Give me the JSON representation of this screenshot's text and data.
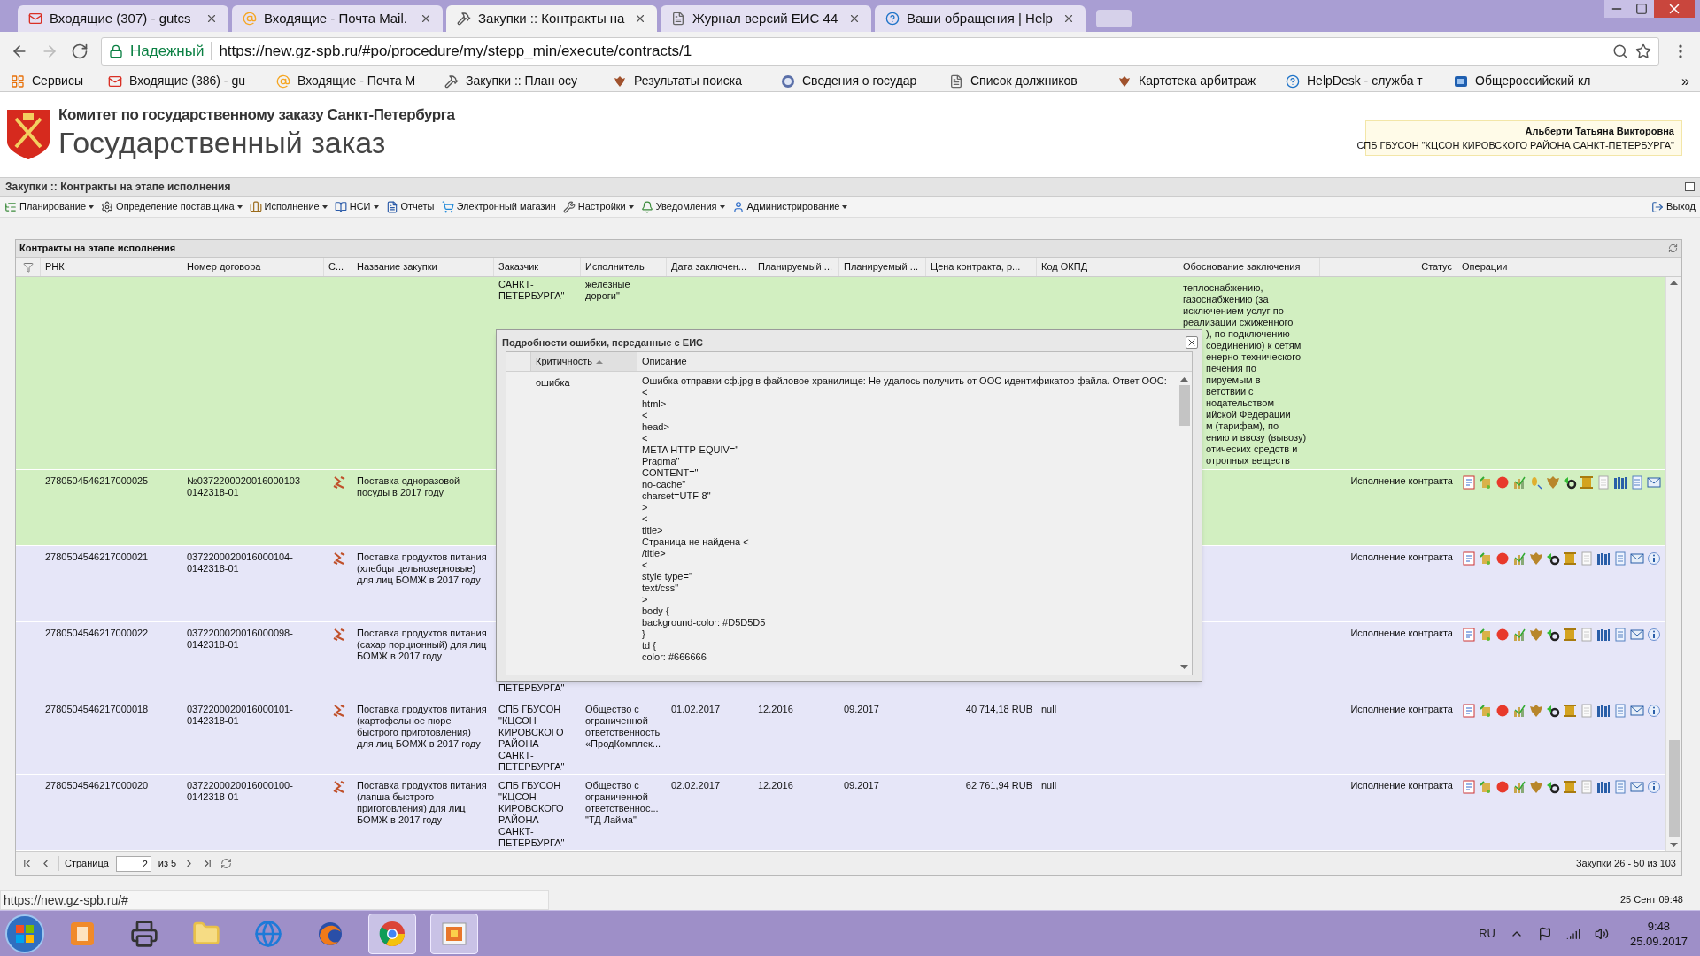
{
  "browser": {
    "tabs": [
      {
        "title": "Входящие (307) - gutcs",
        "selected": false,
        "kind": "mail"
      },
      {
        "title": "Входящие - Почта Mail.",
        "selected": false,
        "kind": "at"
      },
      {
        "title": "Закупки :: Контракты на",
        "selected": true,
        "kind": "hammer"
      },
      {
        "title": "Журнал версий ЕИС 44",
        "selected": false,
        "kind": "page"
      },
      {
        "title": "Ваши обращения | Help",
        "selected": false,
        "kind": "help"
      }
    ],
    "security_label": "Надежный",
    "url": "https://new.gz-spb.ru/#po/procedure/my/stepp_min/execute/contracts/1",
    "bookmarks": [
      {
        "label": "Сервисы",
        "kind": "apps"
      },
      {
        "label": "Входящие (386) - gu",
        "kind": "mail"
      },
      {
        "label": "Входящие - Почта М",
        "kind": "at"
      },
      {
        "label": "Закупки :: План осу",
        "kind": "hammer"
      },
      {
        "label": "Результаты поиска",
        "kind": "emblem"
      },
      {
        "label": "Сведения о государ",
        "kind": "seal"
      },
      {
        "label": "Список должников",
        "kind": "page"
      },
      {
        "label": "Картотека арбитраж",
        "kind": "emblem"
      },
      {
        "label": "HelpDesk - служба т",
        "kind": "help"
      },
      {
        "label": "Общероссийский кл",
        "kind": "logo"
      }
    ],
    "bookmarks_more": "»"
  },
  "header": {
    "organization": "Комитет по государственному заказу Санкт-Петербурга",
    "title": "Государственный заказ",
    "user_name": "Альберти Татьяна Викторовна",
    "user_org": "СПБ ГБУСОН \"КЦСОН КИРОВСКОГО РАЙОНА САНКТ-ПЕТЕРБУРГА\""
  },
  "page_title": "Закупки :: Контракты на этапе исполнения",
  "menu": [
    {
      "label": "Планирование",
      "dropdown": true,
      "kind": "plan"
    },
    {
      "label": "Определение поставщика",
      "dropdown": true,
      "kind": "gears"
    },
    {
      "label": "Исполнение",
      "dropdown": true,
      "kind": "briefcase"
    },
    {
      "label": "НСИ",
      "dropdown": true,
      "kind": "book"
    },
    {
      "label": "Отчеты",
      "dropdown": false,
      "kind": "report"
    },
    {
      "label": "Электронный магазин",
      "dropdown": false,
      "kind": "cart"
    },
    {
      "label": "Настройки",
      "dropdown": true,
      "kind": "wrench"
    },
    {
      "label": "Уведомления",
      "dropdown": true,
      "kind": "bell"
    },
    {
      "label": "Администрирование",
      "dropdown": true,
      "kind": "user"
    }
  ],
  "logout": "Выход",
  "grid": {
    "title": "Контракты на этапе исполнения",
    "columns": [
      "РНК",
      "Номер договора",
      "С...",
      "Название закупки",
      "Заказчик",
      "Исполнитель",
      "Дата заключен...",
      "Планируемый ...",
      "Планируемый ...",
      "Цена контракта, р...",
      "Код ОКПД",
      "Обоснование заключения",
      "Статус",
      "Операции"
    ],
    "rows": [
      {
        "color": "#d2efc1",
        "customer": "САНКТ-\nПЕТЕРБУРГА\"",
        "supplier": "железные\nдороги\"",
        "justification": [
          "теплоснабжению,",
          "газоснабжению (за",
          "исключением услуг по",
          "реализации сжиженного",
          "), по подключению",
          "соединению) к сетям",
          "енерно-технического",
          "печения по",
          "пируемым в",
          "ветствии с",
          "нодательством",
          "ийской Федерации",
          "м (тарифам), по",
          "ению и ввозу (вывозу)",
          "отических средств и",
          "отропных веществ"
        ]
      },
      {
        "color": "#d2efc1",
        "rnk": "2780504546217000025",
        "contract": "№0372200020016000103-0142318-01",
        "name": "Поставка одноразовой посуды в 2017 году",
        "status": "Исполнение контракта",
        "info_icon": false
      },
      {
        "color": "#e6e6f8",
        "rnk": "2780504546217000021",
        "contract": "0372200020016000104-0142318-01",
        "name": "Поставка продуктов питания (хлебцы цельнозерновые) для лиц БОМЖ в 2017 году",
        "status": "Исполнение контракта",
        "info_icon": true
      },
      {
        "color": "#e6e6f8",
        "rnk": "2780504546217000022",
        "contract": "0372200020016000098-0142318-01",
        "name": "Поставка продуктов питания (сахар порционный) для лиц БОМЖ в 2017 году",
        "customer_tail": "ПЕТЕРБУРГА\"",
        "status": "Исполнение контракта",
        "info_icon": true
      },
      {
        "color": "#e6e6f8",
        "rnk": "2780504546217000018",
        "contract": "0372200020016000101-0142318-01",
        "name": "Поставка продуктов питания (картофельное пюре быстрого приготовления) для лиц БОМЖ в 2017 году",
        "customer": "СПБ ГБУСОН\n\"КЦСОН\nКИРОВСКОГО\nРАЙОНА\nСАНКТ-\nПЕТЕРБУРГА\"",
        "supplier": "Общество с\nограниченной\nответственность\n«ПродКомплек...",
        "date": "01.02.2017",
        "plan_1": "12.2016",
        "plan_2": "09.2017",
        "price": "40 714,18 RUB",
        "okpd": "null",
        "status": "Исполнение контракта",
        "info_icon": true
      },
      {
        "color": "#e6e6f8",
        "rnk": "2780504546217000020",
        "contract": "0372200020016000100-0142318-01",
        "name": "Поставка продуктов питания (лапша быстрого приготовления) для лиц БОМЖ в 2017 году",
        "customer": "СПБ ГБУСОН\n\"КЦСОН\nКИРОВСКОГО\nРАЙОНА\nСАНКТ-\nПЕТЕРБУРГА\"",
        "supplier": "Общество с\nограниченной\nответственнос...\n\"ТД Лайма\"",
        "date": "02.02.2017",
        "plan_1": "12.2016",
        "plan_2": "09.2017",
        "price": "62 761,94 RUB",
        "okpd": "null",
        "status": "Исполнение контракта",
        "info_icon": true
      }
    ],
    "pager": {
      "page_label": "Страница",
      "page": "2",
      "of": "из 5"
    },
    "summary": "Закупки 26 - 50 из 103"
  },
  "dialog": {
    "title": "Подробности ошибки, переданные с ЕИС",
    "columns": [
      {
        "label": "Критичность",
        "sorted": true
      },
      {
        "label": "Описание",
        "sorted": false
      }
    ],
    "rows": [
      {
        "severity": "ошибка",
        "description": [
          "Ошибка отправки сф.jpg в файловое хранилище: Не удалось получить от ООС идентификатор файла. Ответ ООС:",
          "<",
          "html>",
          "<",
          "head>",
          "<",
          "META HTTP-EQUIV=\"",
          "Pragma\"",
          "CONTENT=\"",
          "no-cache\"",
          "charset=UTF-8\"",
          ">",
          "<",
          "title>",
          "Страница не найдена <",
          "/title>",
          "<",
          "style type=\"",
          "text/css\"",
          ">",
          "body {",
          "background-color: #D5D5D5",
          "}",
          "td {",
          "color: #666666"
        ]
      }
    ]
  },
  "status_url": "https://new.gz-spb.ru/#",
  "status_time": "25 Сент 09:48",
  "taskbar": {
    "apps": [
      {
        "kind": "tile",
        "selected": false
      },
      {
        "kind": "printer",
        "selected": false
      },
      {
        "kind": "folder",
        "selected": false
      },
      {
        "kind": "globe",
        "selected": false
      },
      {
        "kind": "fox",
        "selected": false
      },
      {
        "kind": "wheel",
        "selected": true
      },
      {
        "kind": "window",
        "selected": true
      }
    ],
    "language": "RU",
    "time": "9:48",
    "date": "25.09.2017"
  }
}
